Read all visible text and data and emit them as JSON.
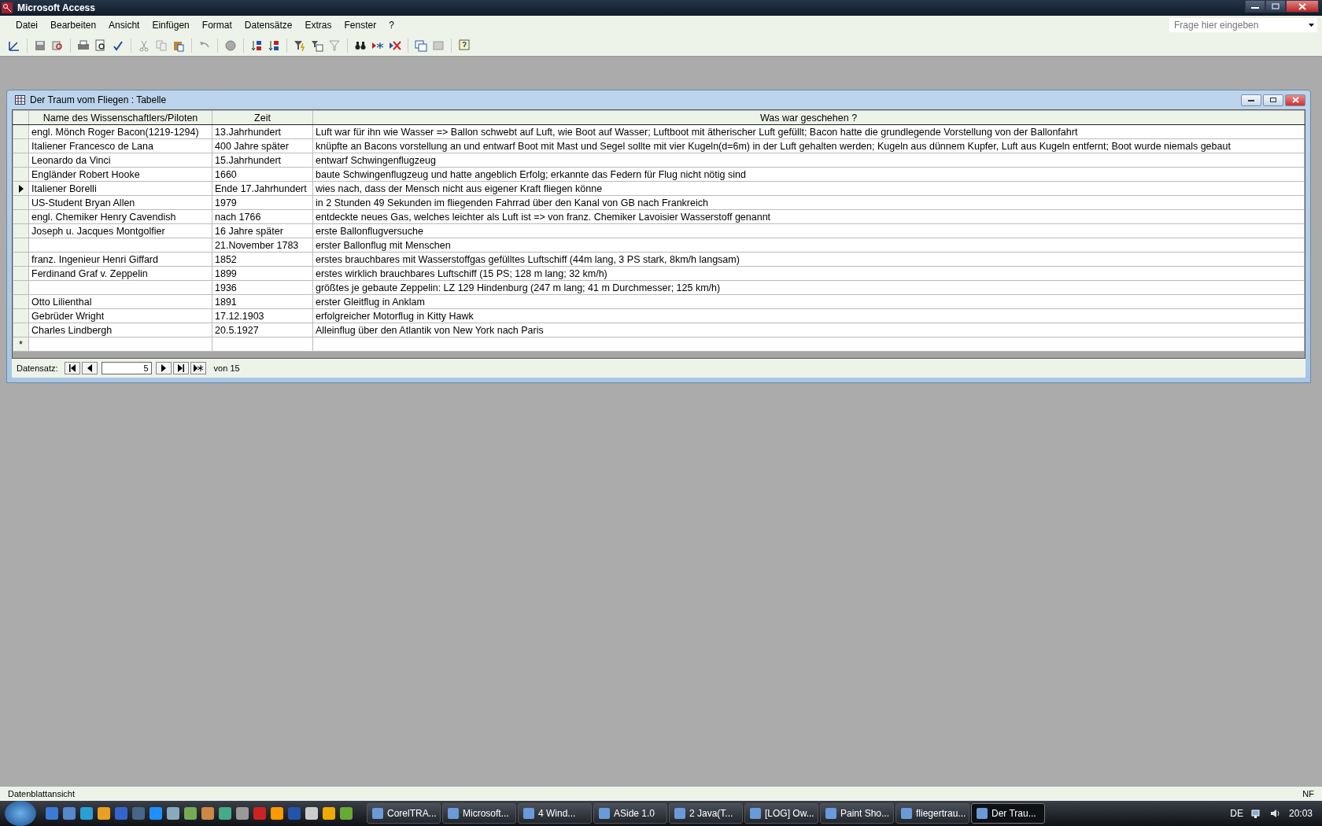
{
  "window": {
    "title": "Microsoft Access"
  },
  "menu": [
    "Datei",
    "Bearbeiten",
    "Ansicht",
    "Einfügen",
    "Format",
    "Datensätze",
    "Extras",
    "Fenster",
    "?"
  ],
  "help_search": {
    "placeholder": "Frage hier eingeben"
  },
  "child_window": {
    "title": "Der Traum vom Fliegen : Tabelle"
  },
  "table": {
    "columns": [
      "Name des Wissenschaftlers/Piloten",
      "Zeit",
      "Was war geschehen ?"
    ],
    "rows": [
      {
        "name": "engl. Mönch Roger Bacon(1219-1294)",
        "time": "13.Jahrhundert",
        "event": "Luft war für ihn wie Wasser => Ballon schwebt auf Luft, wie Boot auf Wasser; Luftboot mit ätherischer Luft gefüllt; Bacon hatte die grundlegende Vorstellung von der Ballonfahrt",
        "selected": false
      },
      {
        "name": "Italiener Francesco de Lana",
        "time": "400 Jahre später",
        "event": "knüpfte an Bacons  vorstellung an und entwarf Boot mit Mast und Segel sollte mit vier Kugeln(d=6m) in der Luft gehalten werden; Kugeln aus dünnem Kupfer, Luft aus Kugeln entfernt; Boot wurde niemals gebaut",
        "selected": false
      },
      {
        "name": "Leonardo da Vinci",
        "time": "15.Jahrhundert",
        "event": "entwarf Schwingenflugzeug",
        "selected": false
      },
      {
        "name": "Engländer Robert Hooke",
        "time": "1660",
        "event": "baute Schwingenflugzeug und hatte angeblich Erfolg; erkannte das Federn für Flug nicht nötig sind",
        "selected": false
      },
      {
        "name": "Italiener Borelli",
        "time": "Ende 17.Jahrhundert",
        "event": "wies nach, dass der Mensch nicht aus eigener Kraft fliegen könne",
        "selected": true
      },
      {
        "name": "US-Student Bryan Allen",
        "time": "1979",
        "event": "in 2 Stunden 49 Sekunden im fliegenden Fahrrad über den Kanal von GB nach Frankreich",
        "selected": false
      },
      {
        "name": "engl. Chemiker Henry Cavendish",
        "time": "nach 1766",
        "event": "entdeckte neues Gas, welches leichter als Luft ist => von franz. Chemiker Lavoisier Wasserstoff genannt",
        "selected": false
      },
      {
        "name": "Joseph u. Jacques Montgolfier",
        "time": "16 Jahre später",
        "event": "erste Ballonflugversuche",
        "selected": false
      },
      {
        "time": "21.November 1783",
        "event": "erster Ballonflug mit Menschen",
        "selected": false
      },
      {
        "name": "franz. Ingenieur Henri Giffard",
        "time": "1852",
        "event": "erstes brauchbares mit Wasserstoffgas gefülltes Luftschiff (44m lang, 3 PS stark, 8km/h langsam)",
        "selected": false
      },
      {
        "name": "Ferdinand Graf v. Zeppelin",
        "time": "1899",
        "event": "erstes wirklich brauchbares Luftschiff (15 PS; 128 m lang; 32 km/h)",
        "selected": false
      },
      {
        "time": "1936",
        "event": "größtes je gebaute Zeppelin: LZ 129 Hindenburg (247 m lang; 41 m Durchmesser; 125 km/h)",
        "selected": false
      },
      {
        "name": "Otto Lilienthal",
        "time": "1891",
        "event": "erster Gleitflug in Anklam",
        "selected": false
      },
      {
        "name": "Gebrüder Wright",
        "time": "17.12.1903",
        "event": "erfolgreicher Motorflug in Kitty Hawk",
        "selected": false
      },
      {
        "name": "Charles Lindbergh",
        "time": "20.5.1927",
        "event": "Alleinflug über den Atlantik von New York nach Paris",
        "selected": false
      }
    ],
    "new_row_marker": "*"
  },
  "record_nav": {
    "label": "Datensatz:",
    "current": "5",
    "of": "von",
    "total": "15"
  },
  "status_bar": {
    "view": "Datenblattansicht",
    "indicator": "NF"
  },
  "taskbar": {
    "buttons": [
      {
        "label": "CorelTRA...",
        "selected": false
      },
      {
        "label": "Microsoft...",
        "selected": false
      },
      {
        "label": "4 Wind...",
        "selected": false
      },
      {
        "label": "ASide 1.0",
        "selected": false
      },
      {
        "label": "2 Java(T...",
        "selected": false
      },
      {
        "label": "[LOG] Ow...",
        "selected": false
      },
      {
        "label": "Paint Sho...",
        "selected": false
      },
      {
        "label": "fliegertrau...",
        "selected": false
      },
      {
        "label": "Der Trau...",
        "selected": true
      }
    ],
    "language": "DE",
    "clock": "20:03"
  }
}
